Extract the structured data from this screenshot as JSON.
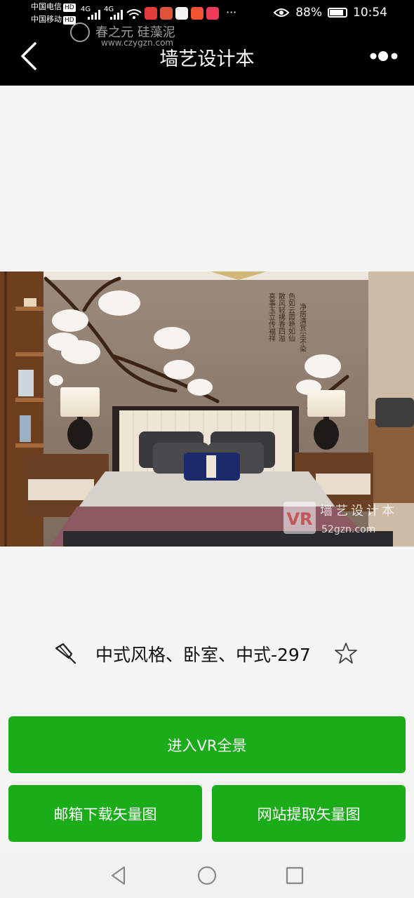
{
  "status_bar": {
    "carrier1": "中国电信",
    "carrier2": "中国移动",
    "hd": "HD",
    "network": "4G",
    "more": "···",
    "battery_percent": "88%",
    "battery_level": 0.88,
    "time": "10:54"
  },
  "watermark": {
    "brand": "春之元 硅藻泥",
    "url": "www.czygzn.com"
  },
  "header": {
    "title": "墙艺设计本",
    "back_icon": "chevron-left-icon",
    "more_icon": "more-dots-icon"
  },
  "photo": {
    "poem_col1": "净居清赏尘不染",
    "poem_col2": "色如云霞艳如仙",
    "poem_col3": "散风轻拂香四溢",
    "poem_col4": "喜事玉立传福祥",
    "logo_vr": "VR",
    "logo_name": "墙艺设计本",
    "logo_url": "52gzn.com"
  },
  "caption": {
    "text": "中式风格、卧室、中式-297",
    "pin_icon": "pin-icon",
    "star_icon": "star-icon"
  },
  "buttons": {
    "vr": "进入VR全景",
    "mail": "邮箱下载矢量图",
    "site": "网站提取矢量图"
  },
  "colors": {
    "accent_green": "#1aad19",
    "header_bg": "#000000",
    "page_bg": "#f5f5f5"
  }
}
